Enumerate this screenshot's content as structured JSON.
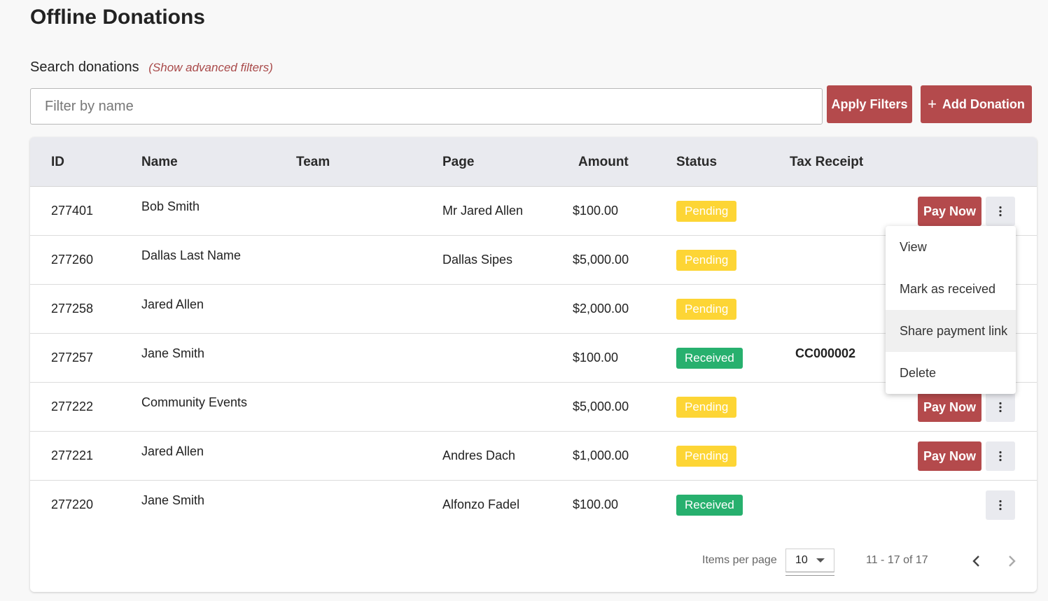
{
  "page": {
    "title": "Offline Donations"
  },
  "search": {
    "label": "Search donations",
    "advanced_link": "(Show advanced filters)",
    "placeholder": "Filter by name",
    "value": ""
  },
  "toolbar": {
    "apply_label": "Apply Filters",
    "add_icon": "+",
    "add_label": "Add Donation"
  },
  "table": {
    "headers": {
      "id": "ID",
      "name": "Name",
      "team": "Team",
      "page": "Page",
      "amount": "Amount",
      "status": "Status",
      "tax_receipt": "Tax Receipt"
    },
    "rows": [
      {
        "id": "277401",
        "name": "Bob Smith",
        "team": "",
        "page": "Mr Jared Allen",
        "amount": "$100.00",
        "status": "Pending",
        "tax_receipt": "",
        "pay_now": "Pay Now"
      },
      {
        "id": "277260",
        "name": "Dallas Last Name",
        "team": "",
        "page": "Dallas Sipes",
        "amount": "$5,000.00",
        "status": "Pending",
        "tax_receipt": "",
        "pay_now": ""
      },
      {
        "id": "277258",
        "name": "Jared Allen",
        "team": "",
        "page": "",
        "amount": "$2,000.00",
        "status": "Pending",
        "tax_receipt": "",
        "pay_now": ""
      },
      {
        "id": "277257",
        "name": "Jane Smith",
        "team": "",
        "page": "",
        "amount": "$100.00",
        "status": "Received",
        "tax_receipt": "CC000002",
        "pay_now": ""
      },
      {
        "id": "277222",
        "name": "Community Events",
        "team": "",
        "page": "",
        "amount": "$5,000.00",
        "status": "Pending",
        "tax_receipt": "",
        "pay_now": "Pay Now"
      },
      {
        "id": "277221",
        "name": "Jared Allen",
        "team": "",
        "page": "Andres Dach",
        "amount": "$1,000.00",
        "status": "Pending",
        "tax_receipt": "",
        "pay_now": "Pay Now"
      },
      {
        "id": "277220",
        "name": "Jane Smith",
        "team": "",
        "page": "Alfonzo Fadel",
        "amount": "$100.00",
        "status": "Received",
        "tax_receipt": "",
        "pay_now": ""
      }
    ],
    "more_icon": "vertical-dots-icon"
  },
  "context_menu": {
    "items": [
      "View",
      "Mark as received",
      "Share payment link",
      "Delete"
    ],
    "hovered_index": 2
  },
  "pagination": {
    "items_per_page_label": "Items per page",
    "items_per_page_value": "10",
    "range": "11 - 17 of 17",
    "prev_icon": "chevron-left-icon",
    "next_icon": "chevron-right-icon"
  },
  "colors": {
    "accent": "#b44a4c",
    "pending": "#fdd535",
    "received": "#27b06e",
    "header_bg": "#e9eaef"
  }
}
